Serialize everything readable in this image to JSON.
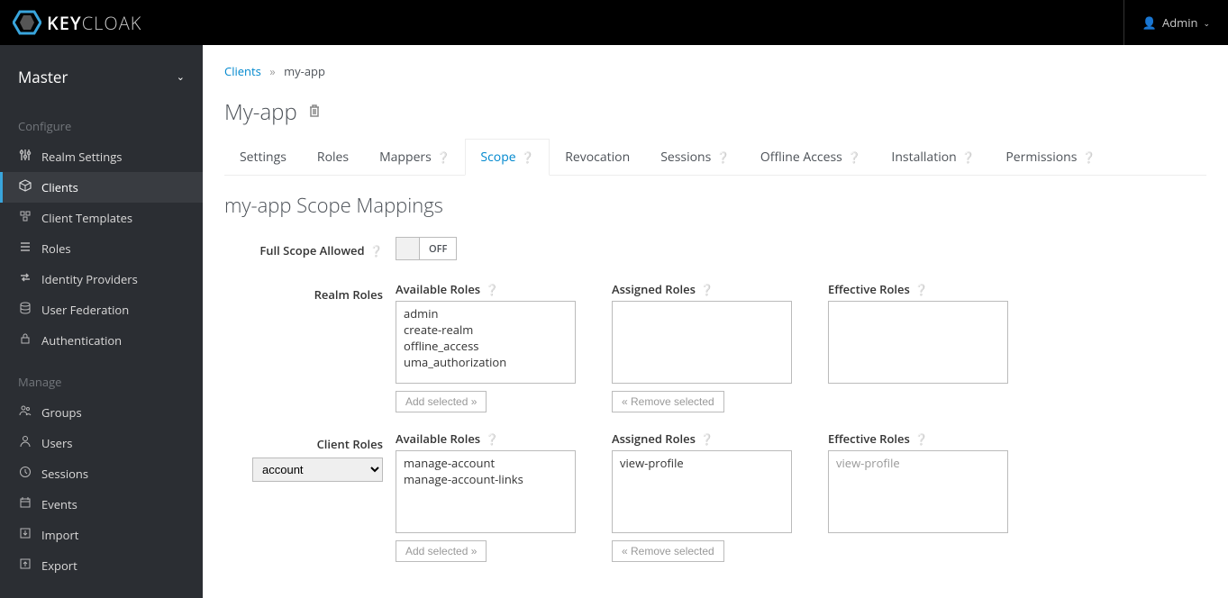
{
  "header": {
    "brand": "KEYCLOAK",
    "user_label": "Admin"
  },
  "sidebar": {
    "realm": "Master",
    "configure_heading": "Configure",
    "manage_heading": "Manage",
    "configure_items": [
      {
        "label": "Realm Settings"
      },
      {
        "label": "Clients"
      },
      {
        "label": "Client Templates"
      },
      {
        "label": "Roles"
      },
      {
        "label": "Identity Providers"
      },
      {
        "label": "User Federation"
      },
      {
        "label": "Authentication"
      }
    ],
    "manage_items": [
      {
        "label": "Groups"
      },
      {
        "label": "Users"
      },
      {
        "label": "Sessions"
      },
      {
        "label": "Events"
      },
      {
        "label": "Import"
      },
      {
        "label": "Export"
      }
    ]
  },
  "breadcrumb": {
    "parent": "Clients",
    "current": "my-app"
  },
  "page": {
    "title": "My-app",
    "tabs": [
      {
        "label": "Settings"
      },
      {
        "label": "Roles"
      },
      {
        "label": "Mappers",
        "help": true
      },
      {
        "label": "Scope",
        "help": true
      },
      {
        "label": "Revocation"
      },
      {
        "label": "Sessions",
        "help": true
      },
      {
        "label": "Offline Access",
        "help": true
      },
      {
        "label": "Installation",
        "help": true
      },
      {
        "label": "Permissions",
        "help": true
      }
    ],
    "section_title": "my-app Scope Mappings",
    "full_scope_label": "Full Scope Allowed",
    "full_scope_value": "OFF",
    "realm_roles_label": "Realm Roles",
    "client_roles_label": "Client Roles",
    "client_select_value": "account",
    "col_headers": {
      "available": "Available Roles",
      "assigned": "Assigned Roles",
      "effective": "Effective Roles"
    },
    "buttons": {
      "add_selected": "Add selected »",
      "remove_selected": "« Remove selected"
    },
    "realm_roles": {
      "available": [
        "admin",
        "create-realm",
        "offline_access",
        "uma_authorization"
      ],
      "assigned": [],
      "effective": []
    },
    "client_roles": {
      "available": [
        "manage-account",
        "manage-account-links"
      ],
      "assigned": [
        "view-profile"
      ],
      "effective": [
        "view-profile"
      ]
    }
  }
}
